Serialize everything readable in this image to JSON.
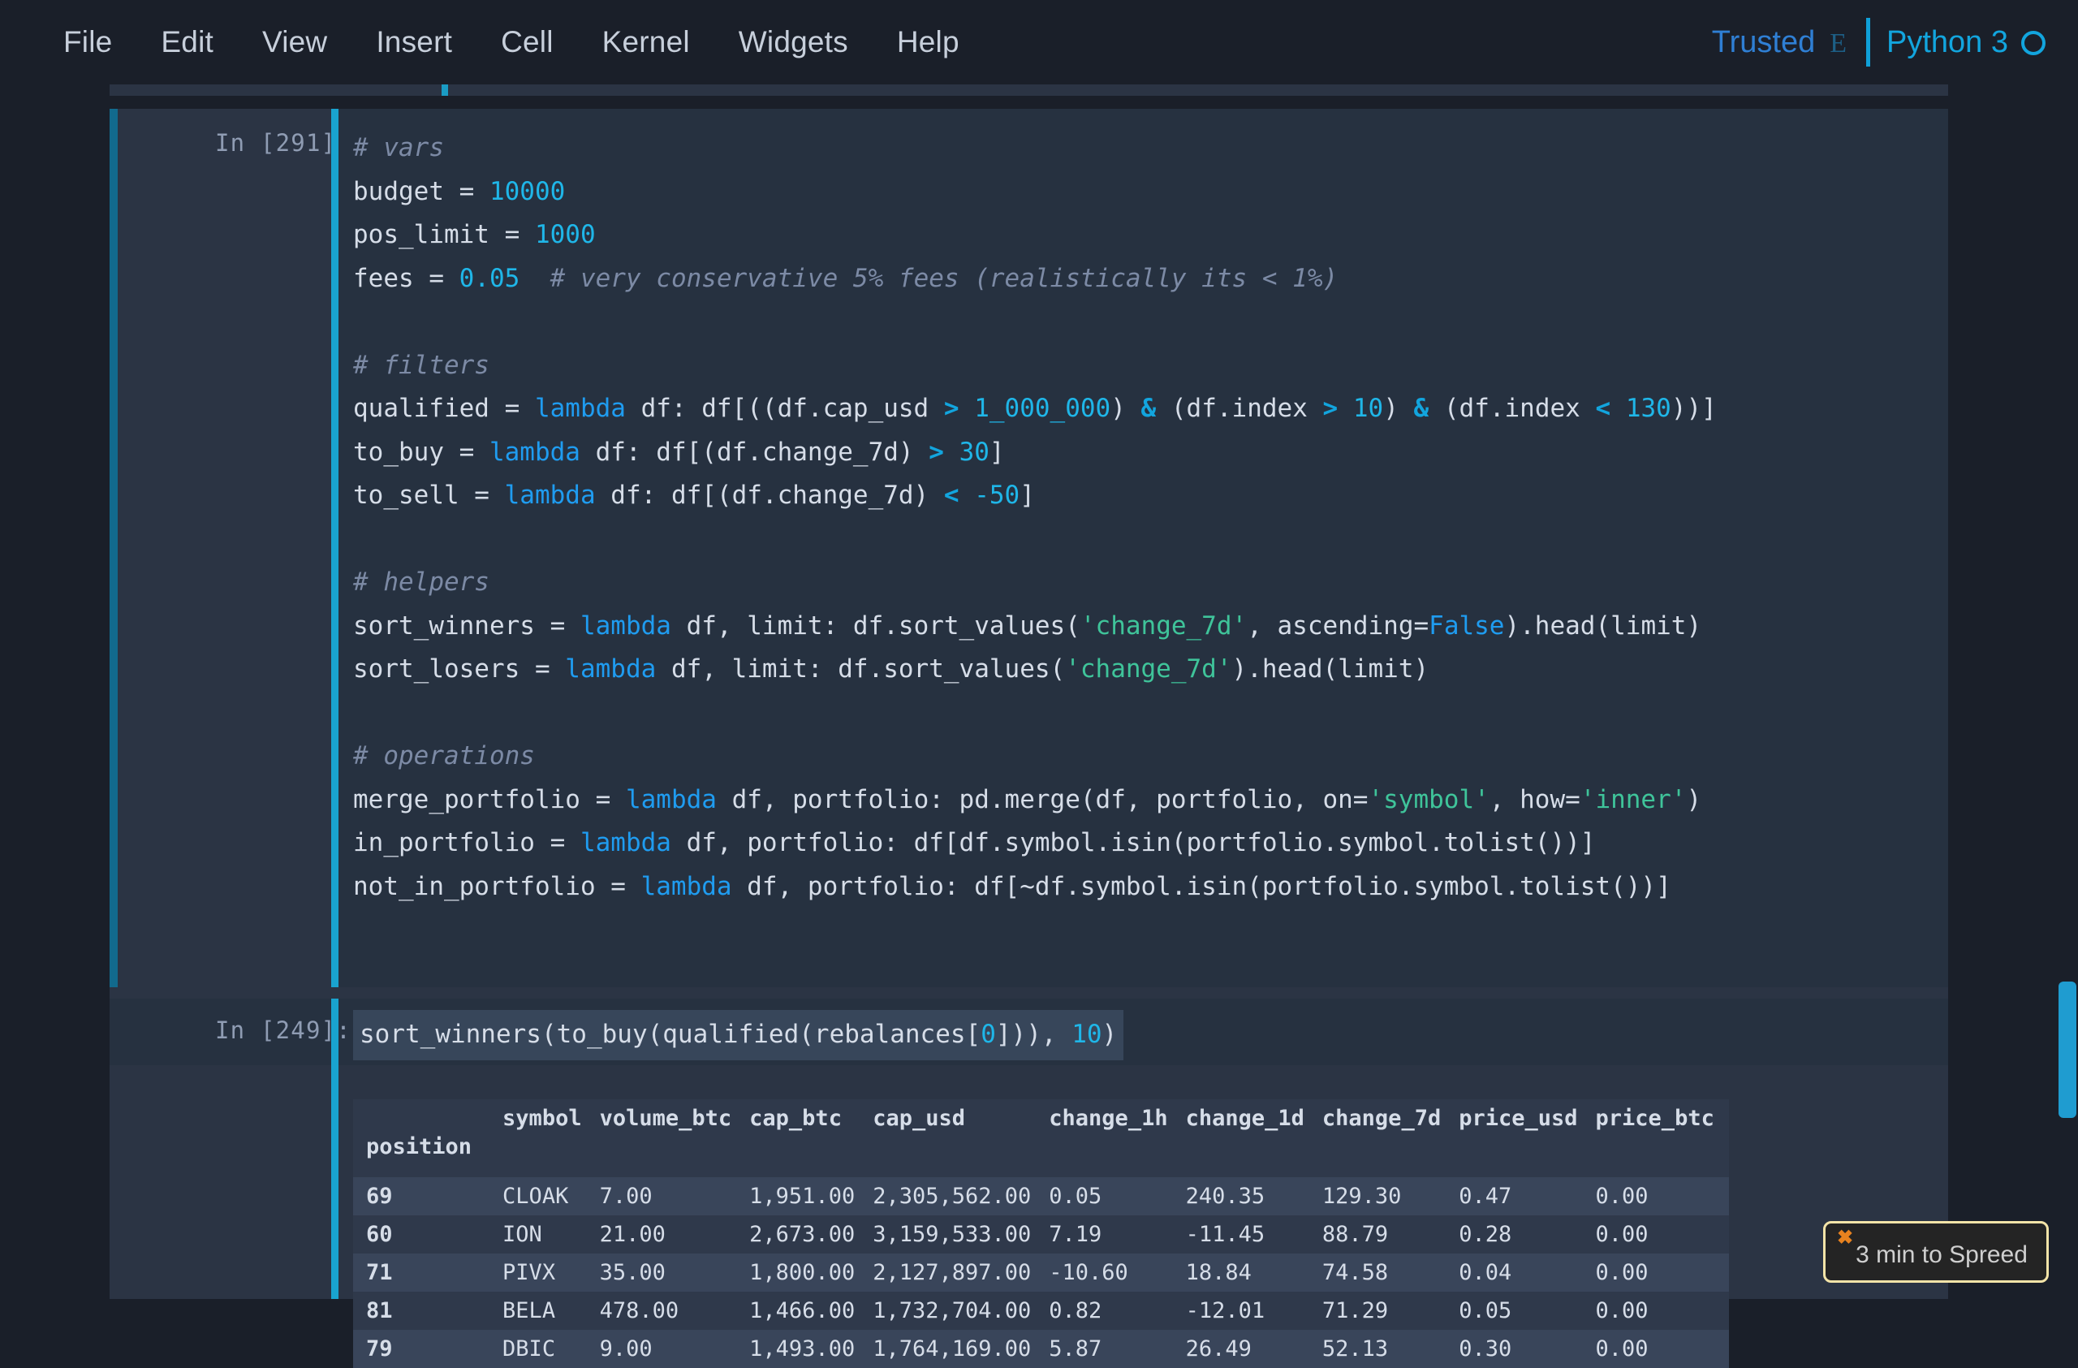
{
  "menu": {
    "items": [
      {
        "label": "File"
      },
      {
        "label": "Edit"
      },
      {
        "label": "View"
      },
      {
        "label": "Insert"
      },
      {
        "label": "Cell"
      },
      {
        "label": "Kernel"
      },
      {
        "label": "Widgets"
      },
      {
        "label": "Help"
      }
    ],
    "trusted_label": "Trusted",
    "trusted_icon": "shield-icon",
    "trusted_glyph": "E",
    "kernel_name": "Python 3",
    "kernel_status_icon": "kernel-idle-circle-icon"
  },
  "colors": {
    "accent_blue": "#12a5de",
    "trusted_blue": "#2f7fd4",
    "comment": "#7c8aa5",
    "string": "#3fc49a",
    "keyword": "#1f9cf0",
    "number": "#1fb6e8",
    "cell_bg": "#263140",
    "page_bg": "#2b3444",
    "app_bg": "#1a1f29",
    "toast_border": "#f4e4a8",
    "toast_close": "#e8821f",
    "scrollbar": "#1f9cd0"
  },
  "cells": [
    {
      "prompt": "In [291]:",
      "selected": true,
      "lines": [
        [
          {
            "t": "# vars",
            "c": "c-com"
          }
        ],
        [
          {
            "t": "budget = "
          },
          {
            "t": "10000",
            "c": "c-num"
          }
        ],
        [
          {
            "t": "pos_limit = "
          },
          {
            "t": "1000",
            "c": "c-num"
          }
        ],
        [
          {
            "t": "fees = "
          },
          {
            "t": "0.05",
            "c": "c-num"
          },
          {
            "t": "  "
          },
          {
            "t": "# very conservative 5% fees (realistically its < 1%)",
            "c": "c-com"
          }
        ],
        [
          {
            "t": ""
          }
        ],
        [
          {
            "t": "# filters",
            "c": "c-com"
          }
        ],
        [
          {
            "t": "qualified = "
          },
          {
            "t": "lambda",
            "c": "c-kw"
          },
          {
            "t": " df: df[((df.cap_usd "
          },
          {
            "t": ">",
            "c": "c-op"
          },
          {
            "t": " "
          },
          {
            "t": "1_000_000",
            "c": "c-num"
          },
          {
            "t": ") "
          },
          {
            "t": "&",
            "c": "c-op"
          },
          {
            "t": " (df.index "
          },
          {
            "t": ">",
            "c": "c-op"
          },
          {
            "t": " "
          },
          {
            "t": "10",
            "c": "c-num"
          },
          {
            "t": ") "
          },
          {
            "t": "&",
            "c": "c-op"
          },
          {
            "t": " (df.index "
          },
          {
            "t": "<",
            "c": "c-op"
          },
          {
            "t": " "
          },
          {
            "t": "130",
            "c": "c-num"
          },
          {
            "t": "))]"
          }
        ],
        [
          {
            "t": "to_buy = "
          },
          {
            "t": "lambda",
            "c": "c-kw"
          },
          {
            "t": " df: df[(df.change_7d) "
          },
          {
            "t": ">",
            "c": "c-op"
          },
          {
            "t": " "
          },
          {
            "t": "30",
            "c": "c-num"
          },
          {
            "t": "]"
          }
        ],
        [
          {
            "t": "to_sell = "
          },
          {
            "t": "lambda",
            "c": "c-kw"
          },
          {
            "t": " df: df[(df.change_7d) "
          },
          {
            "t": "<",
            "c": "c-op"
          },
          {
            "t": " "
          },
          {
            "t": "-50",
            "c": "c-num"
          },
          {
            "t": "]"
          }
        ],
        [
          {
            "t": ""
          }
        ],
        [
          {
            "t": "# helpers",
            "c": "c-com"
          }
        ],
        [
          {
            "t": "sort_winners = "
          },
          {
            "t": "lambda",
            "c": "c-kw"
          },
          {
            "t": " df, limit: df.sort_values("
          },
          {
            "t": "'change_7d'",
            "c": "c-str"
          },
          {
            "t": ", ascending="
          },
          {
            "t": "False",
            "c": "c-kw"
          },
          {
            "t": ").head(limit)"
          }
        ],
        [
          {
            "t": "sort_losers = "
          },
          {
            "t": "lambda",
            "c": "c-kw"
          },
          {
            "t": " df, limit: df.sort_values("
          },
          {
            "t": "'change_7d'",
            "c": "c-str"
          },
          {
            "t": ").head(limit)"
          }
        ],
        [
          {
            "t": ""
          }
        ],
        [
          {
            "t": "# operations",
            "c": "c-com"
          }
        ],
        [
          {
            "t": "merge_portfolio = "
          },
          {
            "t": "lambda",
            "c": "c-kw"
          },
          {
            "t": " df, portfolio: pd.merge(df, portfolio, on="
          },
          {
            "t": "'symbol'",
            "c": "c-str"
          },
          {
            "t": ", how="
          },
          {
            "t": "'inner'",
            "c": "c-str"
          },
          {
            "t": ")"
          }
        ],
        [
          {
            "t": "in_portfolio = "
          },
          {
            "t": "lambda",
            "c": "c-kw"
          },
          {
            "t": " df, portfolio: df[df.symbol.isin(portfolio.symbol.tolist())]"
          }
        ],
        [
          {
            "t": "not_in_portfolio = "
          },
          {
            "t": "lambda",
            "c": "c-kw"
          },
          {
            "t": " df, portfolio: df[~df.symbol.isin(portfolio.symbol.tolist())]"
          }
        ]
      ]
    },
    {
      "prompt": "In [249]:",
      "selected": false,
      "lines": [
        [
          {
            "t": "sort_winners(to_buy(qualified(rebalances["
          },
          {
            "t": "0",
            "c": "c-num"
          },
          {
            "t": "])), "
          },
          {
            "t": "10",
            "c": "c-num"
          },
          {
            "t": ")"
          }
        ]
      ]
    }
  ],
  "output_table": {
    "index_name": "position",
    "columns": [
      "symbol",
      "volume_btc",
      "cap_btc",
      "cap_usd",
      "change_1h",
      "change_1d",
      "change_7d",
      "price_usd",
      "price_btc"
    ],
    "rows": [
      {
        "position": "69",
        "cells": [
          "CLOAK",
          "7.00",
          "1,951.00",
          "2,305,562.00",
          "0.05",
          "240.35",
          "129.30",
          "0.47",
          "0.00"
        ]
      },
      {
        "position": "60",
        "cells": [
          "ION",
          "21.00",
          "2,673.00",
          "3,159,533.00",
          "7.19",
          "-11.45",
          "88.79",
          "0.28",
          "0.00"
        ]
      },
      {
        "position": "71",
        "cells": [
          "PIVX",
          "35.00",
          "1,800.00",
          "2,127,897.00",
          "-10.60",
          "18.84",
          "74.58",
          "0.04",
          "0.00"
        ]
      },
      {
        "position": "81",
        "cells": [
          "BELA",
          "478.00",
          "1,466.00",
          "1,732,704.00",
          "0.82",
          "-12.01",
          "71.29",
          "0.05",
          "0.00"
        ]
      },
      {
        "position": "79",
        "cells": [
          "DBIC",
          "9.00",
          "1,493.00",
          "1,764,169.00",
          "5.87",
          "26.49",
          "52.13",
          "0.30",
          "0.00"
        ]
      }
    ]
  },
  "toast": {
    "close_label": "✖",
    "text": "3 min to Spreed"
  }
}
